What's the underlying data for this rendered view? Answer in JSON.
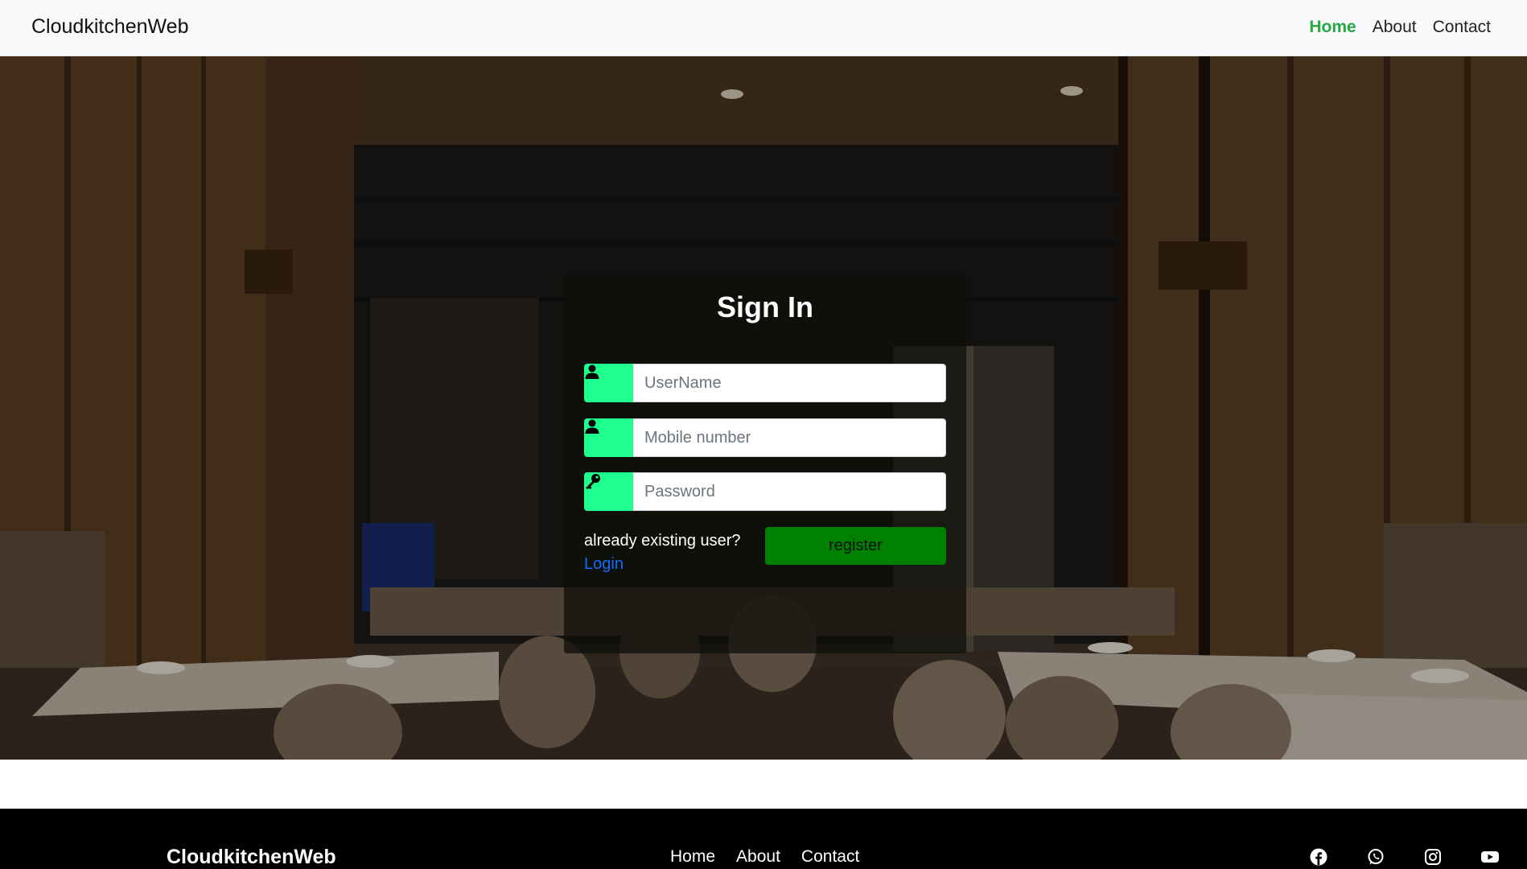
{
  "navbar": {
    "brand": "CloudkitchenWeb",
    "links": [
      {
        "label": "Home",
        "active": true
      },
      {
        "label": "About",
        "active": false
      },
      {
        "label": "Contact",
        "active": false
      }
    ],
    "active_color": "#28a745"
  },
  "signin": {
    "title": "Sign In",
    "username_placeholder": "UserName",
    "mobile_placeholder": "Mobile number",
    "password_placeholder": "Password",
    "existing_user_text": "already existing user?",
    "login_link": "Login",
    "register_label": "register",
    "addon_color": "#1eff8e",
    "register_color": "#008000",
    "icons": [
      "user-icon",
      "user-icon",
      "key-icon"
    ]
  },
  "footer": {
    "brand": "CloudkitchenWeb",
    "links": [
      "Home",
      "About",
      "Contact"
    ],
    "socials": [
      "facebook-icon",
      "whatsapp-icon",
      "instagram-icon",
      "youtube-icon"
    ]
  }
}
